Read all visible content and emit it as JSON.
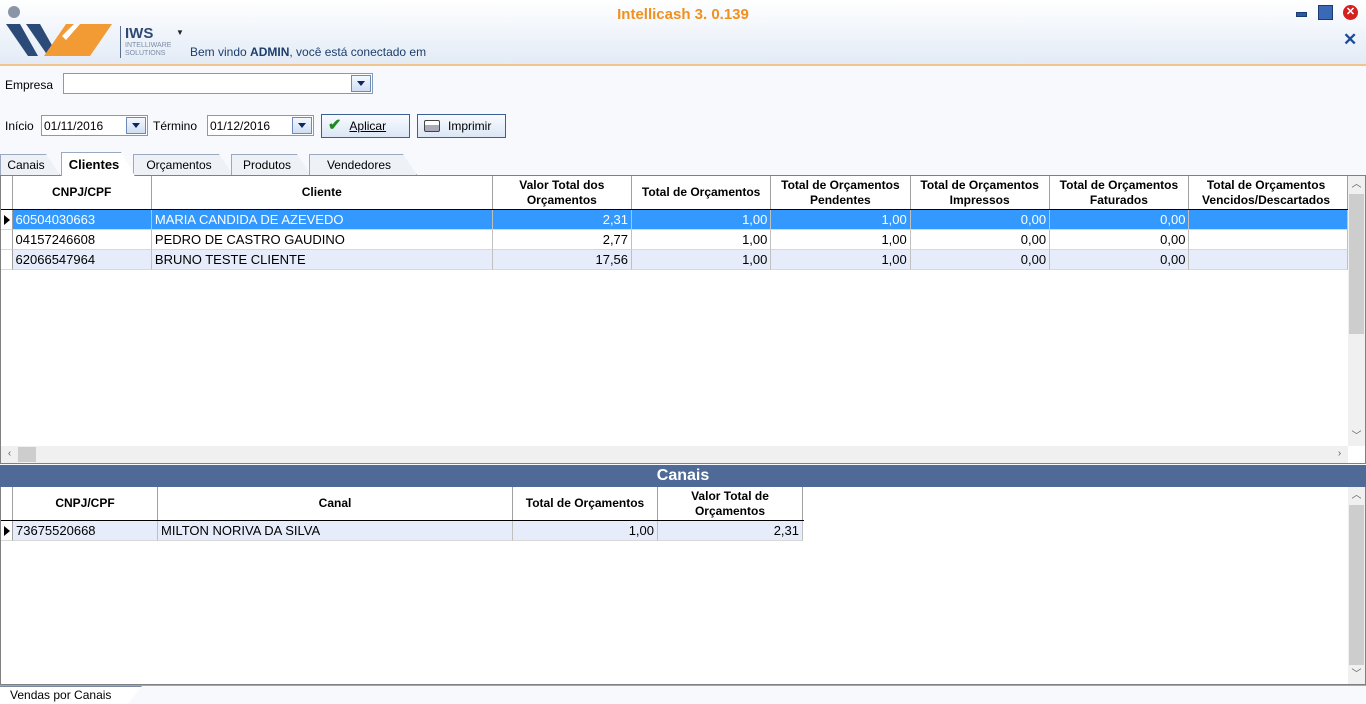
{
  "header": {
    "app_title": "Intellicash 3. 0.139",
    "logo_name": "IWS",
    "logo_sub": "INTELLIWARE SOLUTIONS",
    "welcome_prefix": "Bem vindo ",
    "welcome_user": "ADMIN",
    "welcome_suffix": ", você está conectado em"
  },
  "filters": {
    "empresa_label": "Empresa",
    "empresa_value": "",
    "inicio_label": "Início",
    "inicio_value": "01/11/2016",
    "termino_label": "Término",
    "termino_value": "01/12/2016",
    "apply_label": "Aplicar",
    "print_label": "Imprimir"
  },
  "tabs": [
    "Canais",
    "Clientes",
    "Orçamentos",
    "Produtos",
    "Vendedores"
  ],
  "active_tab": "Clientes",
  "clients_grid": {
    "headers": [
      "CNPJ/CPF",
      "Cliente",
      "Valor Total dos\nOrçamentos",
      "Total de Orçamentos",
      "Total de Orçamentos\nPendentes",
      "Total de Orçamentos\nImpressos",
      "Total de Orçamentos\nFaturados",
      "Total de Orçamentos\nVencidos/Descartados"
    ],
    "rows": [
      [
        "60504030663",
        "MARIA CANDIDA DE AZEVEDO",
        "2,31",
        "1,00",
        "1,00",
        "0,00",
        "0,00",
        ""
      ],
      [
        "04157246608",
        "PEDRO DE CASTRO GAUDINO",
        "2,77",
        "1,00",
        "1,00",
        "0,00",
        "0,00",
        ""
      ],
      [
        "62066547964",
        "BRUNO TESTE CLIENTE",
        "17,56",
        "1,00",
        "1,00",
        "0,00",
        "0,00",
        ""
      ]
    ]
  },
  "canais_section": {
    "title": "Canais",
    "headers": [
      "CNPJ/CPF",
      "Canal",
      "Total de Orçamentos",
      "Valor Total de\nOrçamentos"
    ],
    "rows": [
      [
        "73675520668",
        "MILTON NORIVA DA SILVA",
        "1,00",
        "2,31"
      ]
    ]
  },
  "bottom_tab": "Vendas por Canais",
  "colors": {
    "accent_orange": "#f0901e",
    "selection": "#3399ff",
    "section_bar": "#4f6a96"
  }
}
